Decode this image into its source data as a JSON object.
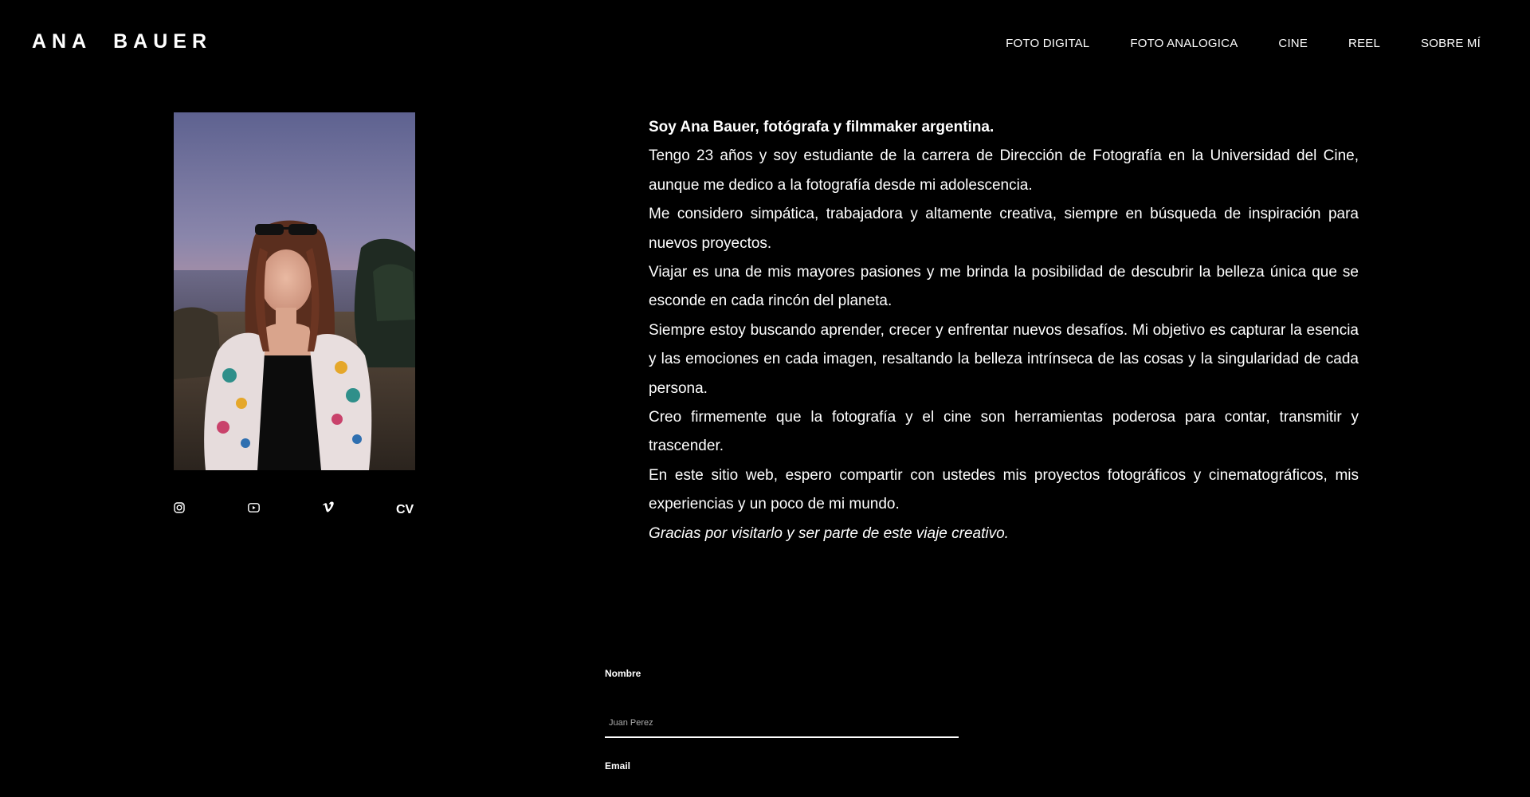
{
  "header": {
    "logo": "ANA  BAUER",
    "nav": [
      {
        "label": "FOTO DIGITAL"
      },
      {
        "label": "FOTO ANALOGICA"
      },
      {
        "label": "CINE"
      },
      {
        "label": "REEL"
      },
      {
        "label": "SOBRE MÍ"
      }
    ]
  },
  "profile": {
    "socials": [
      {
        "icon": "instagram-icon"
      },
      {
        "icon": "youtube-icon"
      },
      {
        "icon": "vimeo-icon"
      },
      {
        "label": "CV"
      }
    ]
  },
  "bio": {
    "lead": "Soy Ana Bauer, fotógrafa y filmmaker argentina.",
    "paragraphs": [
      "Tengo 23 años y soy estudiante de la carrera de Dirección de Fotografía en la Universidad del Cine, aunque me dedico a la fotografía desde mi adolescencia.",
      "Me considero simpática, trabajadora y altamente creativa, siempre en búsqueda de inspiración para nuevos proyectos.",
      "Viajar es una de mis mayores pasiones y me brinda la posibilidad de descubrir la belleza única que se esconde en cada rincón del planeta.",
      "Siempre estoy buscando aprender, crecer y enfrentar nuevos desafíos. Mi objetivo es capturar la esencia y las emociones en cada imagen, resaltando la belleza intrínseca de las cosas y la singularidad de cada persona.",
      "Creo firmemente que la fotografía y el cine son herramientas poderosa para contar, transmitir y trascender.",
      "En este sitio web, espero compartir con ustedes mis proyectos fotográficos y cinematográficos, mis experiencias y un poco de mi mundo."
    ],
    "closing": "Gracias por visitarlo y ser parte de este viaje creativo."
  },
  "form": {
    "name_label": "Nombre",
    "name_placeholder": "Juan Perez",
    "email_label": "Email"
  },
  "colors": {
    "background": "#000000",
    "text": "#ffffff"
  }
}
